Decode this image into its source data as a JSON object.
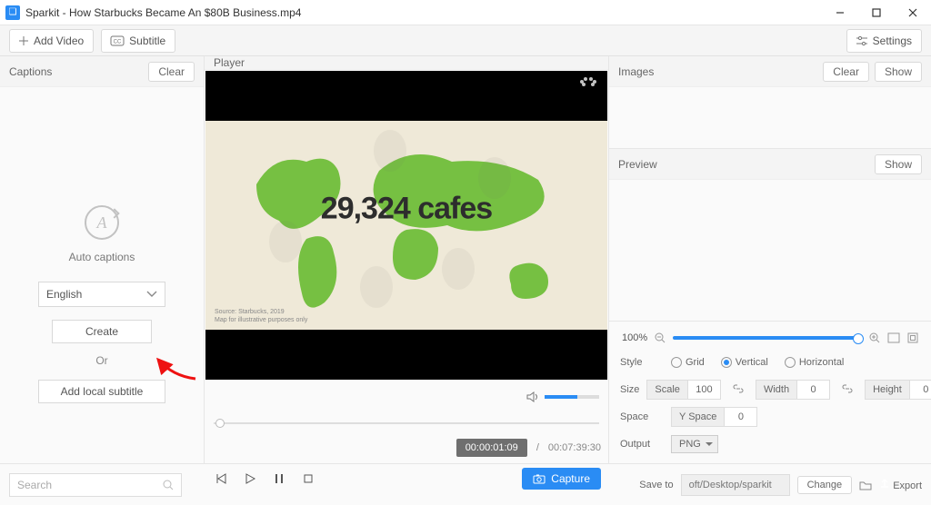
{
  "window": {
    "title": "Sparkit - How Starbucks Became An $80B Business.mp4"
  },
  "toolbar": {
    "add_video": "Add Video",
    "subtitle": "Subtitle",
    "settings": "Settings"
  },
  "captions": {
    "header": "Captions",
    "clear": "Clear",
    "auto_label": "Auto captions",
    "language": "English",
    "create": "Create",
    "or": "Or",
    "add_local": "Add local subtitle"
  },
  "player": {
    "header": "Player",
    "current_time": "00:00:01:09",
    "duration": "00:07:39:30",
    "separator": "/",
    "capture": "Capture",
    "frame_caption": "29,324 cafes",
    "source_line1": "Source: Starbucks, 2019",
    "source_line2": "Map for illustrative purposes only"
  },
  "images": {
    "header": "Images",
    "clear": "Clear",
    "show": "Show"
  },
  "preview": {
    "header": "Preview",
    "show": "Show"
  },
  "props": {
    "zoom_pct": "100%",
    "style_label": "Style",
    "style_grid": "Grid",
    "style_vertical": "Vertical",
    "style_horizontal": "Horizontal",
    "size_label": "Size",
    "scale_label": "Scale",
    "scale_val": "100",
    "width_label": "Width",
    "width_val": "0",
    "height_label": "Height",
    "height_val": "0",
    "space_label": "Space",
    "yspace_label": "Y Space",
    "yspace_val": "0",
    "output_label": "Output",
    "output_fmt": "PNG"
  },
  "bottom": {
    "search_placeholder": "Search",
    "save_to": "Save to",
    "path": "oft/Desktop/sparkit",
    "change": "Change",
    "export": "Export"
  }
}
